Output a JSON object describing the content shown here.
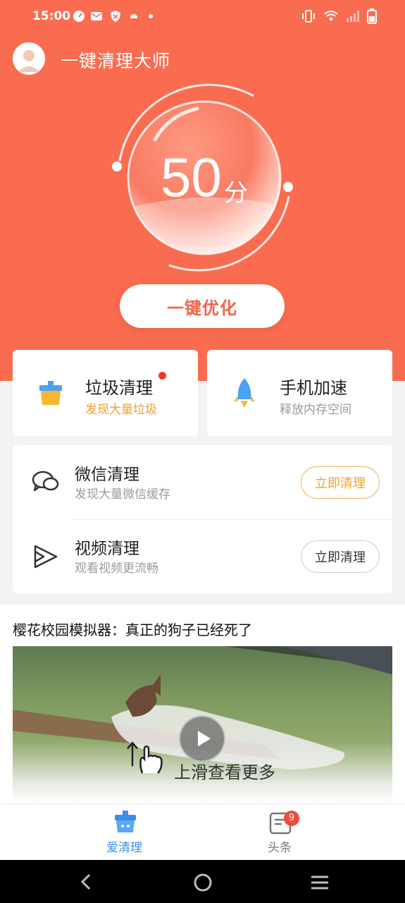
{
  "status_bar": {
    "time": "15:00"
  },
  "header": {
    "title": "一键清理大师"
  },
  "score": {
    "value": "50",
    "unit": "分"
  },
  "optimize_button": "一键优化",
  "features": [
    {
      "title": "垃圾清理",
      "subtitle": "发现大量垃圾",
      "icon": "trash-bin-icon",
      "subtitle_color": "#f0a030"
    },
    {
      "title": "手机加速",
      "subtitle": "释放内存空间",
      "icon": "rocket-icon",
      "subtitle_color": "#9a9a9a"
    }
  ],
  "clean_rows": [
    {
      "title": "微信清理",
      "subtitle": "发现大量微信缓存",
      "button": "立即清理",
      "icon": "wechat-icon"
    },
    {
      "title": "视频清理",
      "subtitle": "观看视频更流畅",
      "button": "立即清理",
      "icon": "video-play-icon"
    }
  ],
  "news": {
    "title": "樱花校园模拟器：真正的狗子已经死了",
    "swipe_hint": "上滑查看更多"
  },
  "tabbar": {
    "tabs": [
      {
        "label": "爱清理",
        "active": true
      },
      {
        "label": "头条",
        "active": false,
        "badge": "9"
      }
    ]
  },
  "colors": {
    "brand": "#fa6c50",
    "active_tab": "#3a8ee8",
    "inactive_tab": "#777777"
  }
}
